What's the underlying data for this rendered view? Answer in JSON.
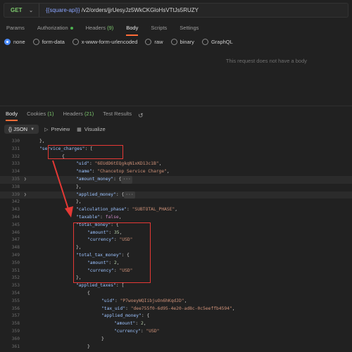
{
  "request": {
    "method": "GET",
    "url_var": "{{square-api}}",
    "url_path": "/v2/orders/jjrUesyJz5WkCKGloHsVTtJs5RUZY"
  },
  "req_tabs": [
    {
      "label": "Params"
    },
    {
      "label": "Authorization"
    },
    {
      "label": "Headers",
      "count": "(9)"
    },
    {
      "label": "Body"
    },
    {
      "label": "Scripts"
    },
    {
      "label": "Settings"
    }
  ],
  "body_types": [
    "none",
    "form-data",
    "x-www-form-urlencoded",
    "raw",
    "binary",
    "GraphQL"
  ],
  "no_body_text": "This request does not have a body",
  "resp_tabs": [
    {
      "label": "Body"
    },
    {
      "label": "Cookies",
      "count": "(1)"
    },
    {
      "label": "Headers",
      "count": "(21)"
    },
    {
      "label": "Test Results"
    }
  ],
  "resp_tools": {
    "format": "JSON",
    "preview": "Preview",
    "visualize": "Visualize"
  },
  "code_lines": [
    {
      "num": "330",
      "html": ""
    },
    {
      "num": "331",
      "html": ""
    },
    {
      "num": "332",
      "html": ""
    },
    {
      "num": "333",
      "html": ""
    },
    {
      "num": "334",
      "html": ""
    },
    {
      "num": "335",
      "html": ""
    },
    {
      "num": "338",
      "html": ""
    },
    {
      "num": "339",
      "html": ""
    },
    {
      "num": "342",
      "html": ""
    },
    {
      "num": "343",
      "html": ""
    },
    {
      "num": "344",
      "html": ""
    },
    {
      "num": "345",
      "html": ""
    },
    {
      "num": "346",
      "html": ""
    },
    {
      "num": "347",
      "html": ""
    },
    {
      "num": "348",
      "html": ""
    },
    {
      "num": "349",
      "html": ""
    },
    {
      "num": "350",
      "html": ""
    },
    {
      "num": "351",
      "html": ""
    },
    {
      "num": "352",
      "html": ""
    },
    {
      "num": "353",
      "html": ""
    },
    {
      "num": "354",
      "html": ""
    },
    {
      "num": "355",
      "html": ""
    },
    {
      "num": "356",
      "html": ""
    },
    {
      "num": "357",
      "html": ""
    },
    {
      "num": "358",
      "html": ""
    },
    {
      "num": "359",
      "html": ""
    },
    {
      "num": "360",
      "html": ""
    },
    {
      "num": "361",
      "html": ""
    }
  ],
  "code": {
    "l330": "},",
    "l331_key": "\"service_charges\"",
    "l331_rest": ": [",
    "l332": "{",
    "l333_key": "\"uid\"",
    "l333_val": "\"6EUdD6tEQgkqN1xKD13c1B\"",
    "l334_key": "\"name\"",
    "l334_val": "\"Chancetop Service Charge\"",
    "l335_key": "\"amount_money\"",
    "l335_rest": ": {",
    "l338": "},",
    "l339_key": "\"applied_money\"",
    "l339_rest": ": {",
    "l342": "},",
    "l343_key": "\"calculation_phase\"",
    "l343_val": "\"SUBTOTAL_PHASE\"",
    "l344_key": "\"taxable\"",
    "l344_val": "false",
    "l345_key": "\"total_money\"",
    "l345_rest": ": {",
    "l346_key": "\"amount\"",
    "l346_val": "35",
    "l347_key": "\"currency\"",
    "l347_val": "\"USD\"",
    "l348": "},",
    "l349_key": "\"total_tax_money\"",
    "l349_rest": ": {",
    "l350_key": "\"amount\"",
    "l350_val": "2",
    "l351_key": "\"currency\"",
    "l351_val": "\"USD\"",
    "l352": "},",
    "l353_key": "\"applied_taxes\"",
    "l353_rest": ": [",
    "l354": "{",
    "l355_key": "\"uid\"",
    "l355_val": "\"P7woeyWQIibjuOn6hKqdJD\"",
    "l356_key": "\"tax_uid\"",
    "l356_val": "\"dee755f0-6d95-4e20-ad8c-0c5eeffb4594\"",
    "l357_key": "\"applied_money\"",
    "l357_rest": ": {",
    "l358_key": "\"amount\"",
    "l358_val": "2",
    "l359_key": "\"currency\"",
    "l359_val": "\"USD\"",
    "l360": "}",
    "l361": "}",
    "fold": "···"
  }
}
